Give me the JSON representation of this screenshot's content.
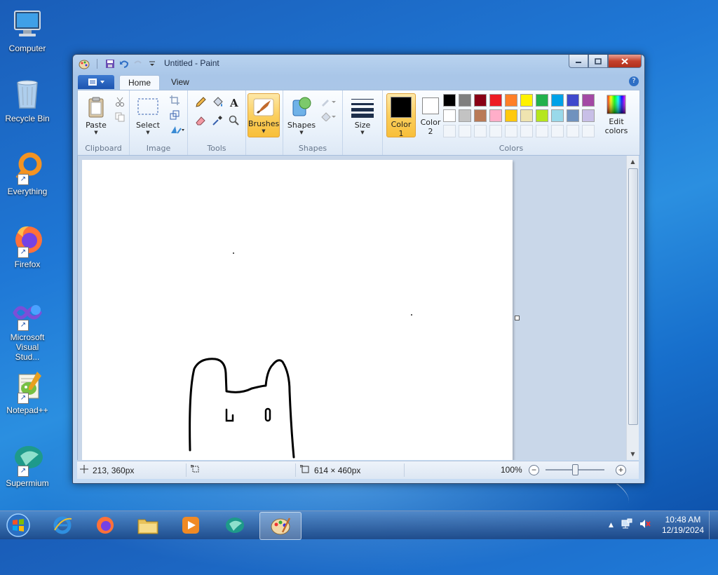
{
  "desktop": {
    "icons": [
      {
        "label": "Computer"
      },
      {
        "label": "Recycle Bin"
      },
      {
        "label": "Everything"
      },
      {
        "label": "Firefox"
      },
      {
        "label": "Microsoft Visual Stud..."
      },
      {
        "label": "Notepad++"
      },
      {
        "label": "Supermium"
      }
    ]
  },
  "window": {
    "title": "Untitled - Paint",
    "tabs": [
      {
        "label": "Home"
      },
      {
        "label": "View"
      }
    ],
    "help_label": "?"
  },
  "ribbon": {
    "clipboard": {
      "paste_label": "Paste",
      "group_label": "Clipboard"
    },
    "image": {
      "select_label": "Select",
      "group_label": "Image"
    },
    "tools": {
      "group_label": "Tools"
    },
    "brushes": {
      "label": "Brushes"
    },
    "shapes": {
      "label": "Shapes",
      "group_label": "Shapes"
    },
    "size": {
      "label": "Size"
    },
    "colors": {
      "color1_line1": "Color",
      "color1_line2": "1",
      "color2_line1": "Color",
      "color2_line2": "2",
      "edit_line1": "Edit",
      "edit_line2": "colors",
      "group_label": "Colors",
      "color1_value": "#000000",
      "color2_value": "#ffffff",
      "palette_row1": [
        "#000000",
        "#7f7f7f",
        "#880015",
        "#ed1c24",
        "#ff7f27",
        "#fff200",
        "#22b14c",
        "#00a2e8",
        "#3f48cc",
        "#a349a4"
      ],
      "palette_row2": [
        "#ffffff",
        "#c3c3c3",
        "#b97a57",
        "#ffaec9",
        "#ffc90e",
        "#efe4b0",
        "#b5e61d",
        "#99d9ea",
        "#7092be",
        "#c8bfe7"
      ]
    }
  },
  "statusbar": {
    "cursor_pos": "213, 360px",
    "image_size": "614 × 460px",
    "zoom": "100%"
  },
  "taskbar": {
    "time": "10:48 AM",
    "date": "12/19/2024"
  }
}
